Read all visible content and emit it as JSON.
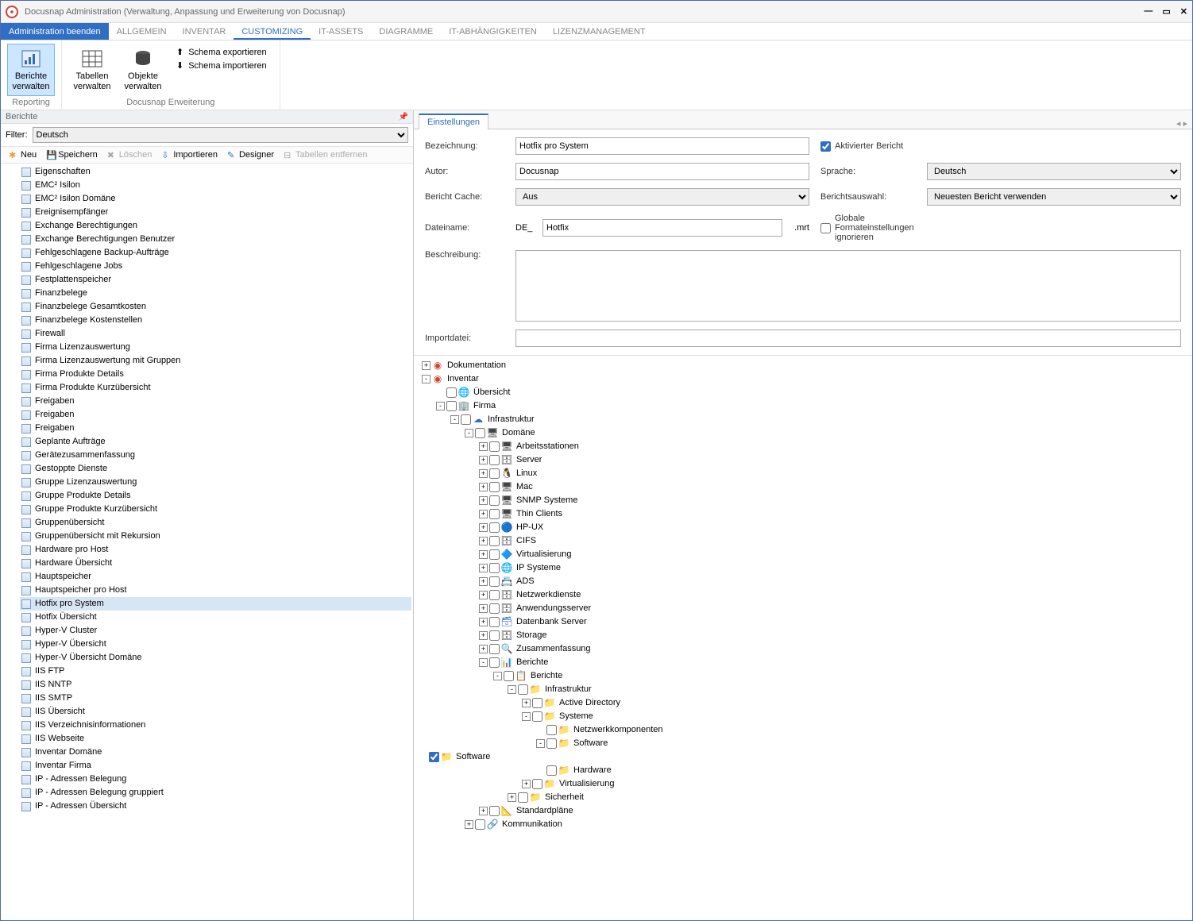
{
  "window": {
    "title": "Docusnap Administration (Verwaltung, Anpassung und Erweiterung von Docusnap)"
  },
  "menu": {
    "exit": "Administration beenden",
    "items": [
      "ALLGEMEIN",
      "INVENTAR",
      "CUSTOMIZING",
      "IT-ASSETS",
      "DIAGRAMME",
      "IT-ABHÄNGIGKEITEN",
      "LIZENZMANAGEMENT"
    ],
    "active": "CUSTOMIZING"
  },
  "ribbon": {
    "buttons": {
      "b1": "Berichte\nverwalten",
      "b2": "Tabellen\nverwalten",
      "b3": "Objekte\nverwalten"
    },
    "schema_export": "Schema exportieren",
    "schema_import": "Schema importieren",
    "sec1": "Reporting",
    "sec2": "Docusnap Erweiterung"
  },
  "leftpane": {
    "title": "Berichte",
    "filter_label": "Filter:",
    "filter_value": "Deutsch",
    "toolbar": {
      "neu": "Neu",
      "speichern": "Speichern",
      "loeschen": "Löschen",
      "importieren": "Importieren",
      "designer": "Designer",
      "tabellen_entfernen": "Tabellen entfernen"
    },
    "reports": [
      "Eigenschaften",
      "EMC² Isilon",
      "EMC² Isilon Domäne",
      "Ereignisempfänger",
      "Exchange Berechtigungen",
      "Exchange Berechtigungen Benutzer",
      "Fehlgeschlagene Backup-Aufträge",
      "Fehlgeschlagene Jobs",
      "Festplattenspeicher",
      "Finanzbelege",
      "Finanzbelege Gesamtkosten",
      "Finanzbelege Kostenstellen",
      "Firewall",
      "Firma Lizenzauswertung",
      "Firma Lizenzauswertung mit Gruppen",
      "Firma Produkte Details",
      "Firma Produkte Kurzübersicht",
      "Freigaben",
      "Freigaben",
      "Freigaben",
      "Geplante Aufträge",
      "Gerätezusammenfassung",
      "Gestoppte Dienste",
      "Gruppe Lizenzauswertung",
      "Gruppe Produkte Details",
      "Gruppe Produkte Kurzübersicht",
      "Gruppenübersicht",
      "Gruppenübersicht mit Rekursion",
      "Hardware pro Host",
      "Hardware Übersicht",
      "Hauptspeicher",
      "Hauptspeicher pro Host",
      "Hotfix pro System",
      "Hotfix Übersicht",
      "Hyper-V Cluster",
      "Hyper-V Übersicht",
      "Hyper-V Übersicht Domäne",
      "IIS FTP",
      "IIS NNTP",
      "IIS SMTP",
      "IIS Übersicht",
      "IIS Verzeichnisinformationen",
      "IIS Webseite",
      "Inventar Domäne",
      "Inventar Firma",
      "IP - Adressen Belegung",
      "IP - Adressen Belegung gruppiert",
      "IP - Adressen Übersicht"
    ],
    "selected": "Hotfix pro System"
  },
  "rightpane": {
    "tab": "Einstellungen",
    "labels": {
      "bezeichnung": "Bezeichnung:",
      "autor": "Autor:",
      "cache": "Bericht Cache:",
      "dateiname": "Dateiname:",
      "beschreibung": "Beschreibung:",
      "importdatei": "Importdatei:",
      "aktiviert": "Aktivierter Bericht",
      "sprache": "Sprache:",
      "auswahl": "Berichtsauswahl:",
      "global": "Globale Formateinstellungen ignorieren"
    },
    "values": {
      "bezeichnung": "Hotfix pro System",
      "autor": "Docusnap",
      "cache": "Aus",
      "dateiname_prefix": "DE_",
      "dateiname": "Hotfix",
      "dateiname_suffix": ".mrt",
      "beschreibung": "",
      "importdatei": "",
      "aktiviert_checked": true,
      "sprache": "Deutsch",
      "auswahl": "Neuesten Bericht verwenden",
      "global_checked": false
    }
  },
  "tree": [
    {
      "l": 0,
      "tog": "+",
      "cb": null,
      "icn": "🔴",
      "txt": "Dokumentation"
    },
    {
      "l": 0,
      "tog": "-",
      "cb": null,
      "icn": "🔴",
      "txt": "Inventar"
    },
    {
      "l": 1,
      "tog": "",
      "cb": false,
      "icn": "🌐",
      "txt": "Übersicht"
    },
    {
      "l": 1,
      "tog": "-",
      "cb": false,
      "icn": "🏢",
      "txt": "Firma"
    },
    {
      "l": 2,
      "tog": "-",
      "cb": false,
      "icn": "☁",
      "txt": "Infrastruktur"
    },
    {
      "l": 3,
      "tog": "-",
      "cb": false,
      "icn": "🖥",
      "txt": "Domäne"
    },
    {
      "l": 4,
      "tog": "+",
      "cb": false,
      "icn": "🖥",
      "txt": "Arbeitsstationen"
    },
    {
      "l": 4,
      "tog": "+",
      "cb": false,
      "icn": "🗄",
      "txt": "Server"
    },
    {
      "l": 4,
      "tog": "+",
      "cb": false,
      "icn": "🐧",
      "txt": "Linux"
    },
    {
      "l": 4,
      "tog": "+",
      "cb": false,
      "icn": "🖥",
      "txt": "Mac"
    },
    {
      "l": 4,
      "tog": "+",
      "cb": false,
      "icn": "🖥",
      "txt": "SNMP Systeme"
    },
    {
      "l": 4,
      "tog": "+",
      "cb": false,
      "icn": "🖥",
      "txt": "Thin Clients"
    },
    {
      "l": 4,
      "tog": "+",
      "cb": false,
      "icn": "🔵",
      "txt": "HP-UX"
    },
    {
      "l": 4,
      "tog": "+",
      "cb": false,
      "icn": "🗄",
      "txt": "CIFS"
    },
    {
      "l": 4,
      "tog": "+",
      "cb": false,
      "icn": "🔷",
      "txt": "Virtualisierung"
    },
    {
      "l": 4,
      "tog": "+",
      "cb": false,
      "icn": "🌐",
      "txt": "IP Systeme"
    },
    {
      "l": 4,
      "tog": "+",
      "cb": false,
      "icn": "📇",
      "txt": "ADS"
    },
    {
      "l": 4,
      "tog": "+",
      "cb": false,
      "icn": "🗄",
      "txt": "Netzwerkdienste"
    },
    {
      "l": 4,
      "tog": "+",
      "cb": false,
      "icn": "🗄",
      "txt": "Anwendungsserver"
    },
    {
      "l": 4,
      "tog": "+",
      "cb": false,
      "icn": "🗃",
      "txt": "Datenbank Server"
    },
    {
      "l": 4,
      "tog": "+",
      "cb": false,
      "icn": "🗄",
      "txt": "Storage"
    },
    {
      "l": 4,
      "tog": "+",
      "cb": false,
      "icn": "🔍",
      "txt": "Zusammenfassung"
    },
    {
      "l": 4,
      "tog": "-",
      "cb": false,
      "icn": "📊",
      "txt": "Berichte"
    },
    {
      "l": 5,
      "tog": "-",
      "cb": false,
      "icn": "📋",
      "txt": "Berichte"
    },
    {
      "l": 6,
      "tog": "-",
      "cb": false,
      "icn": "📁",
      "txt": "Infrastruktur"
    },
    {
      "l": 7,
      "tog": "+",
      "cb": false,
      "icn": "📁",
      "txt": "Active Directory"
    },
    {
      "l": 7,
      "tog": "-",
      "cb": false,
      "icn": "📁",
      "txt": "Systeme"
    },
    {
      "l": 8,
      "tog": "",
      "cb": false,
      "icn": "📁",
      "txt": "Netzwerkkomponenten"
    },
    {
      "l": 8,
      "tog": "-",
      "cb": false,
      "icn": "📁",
      "txt": "Software"
    },
    {
      "l": 8,
      "tog": "",
      "cb": true,
      "icn": "📁",
      "txt": "Software",
      "extra": true
    },
    {
      "l": 8,
      "tog": "",
      "cb": false,
      "icn": "📁",
      "txt": "Hardware"
    },
    {
      "l": 7,
      "tog": "+",
      "cb": false,
      "icn": "📁",
      "txt": "Virtualisierung"
    },
    {
      "l": 6,
      "tog": "+",
      "cb": false,
      "icn": "📁",
      "txt": "Sicherheit"
    },
    {
      "l": 4,
      "tog": "+",
      "cb": false,
      "icn": "📐",
      "txt": "Standardpläne"
    },
    {
      "l": 3,
      "tog": "+",
      "cb": false,
      "icn": "🔗",
      "txt": "Kommunikation"
    }
  ]
}
